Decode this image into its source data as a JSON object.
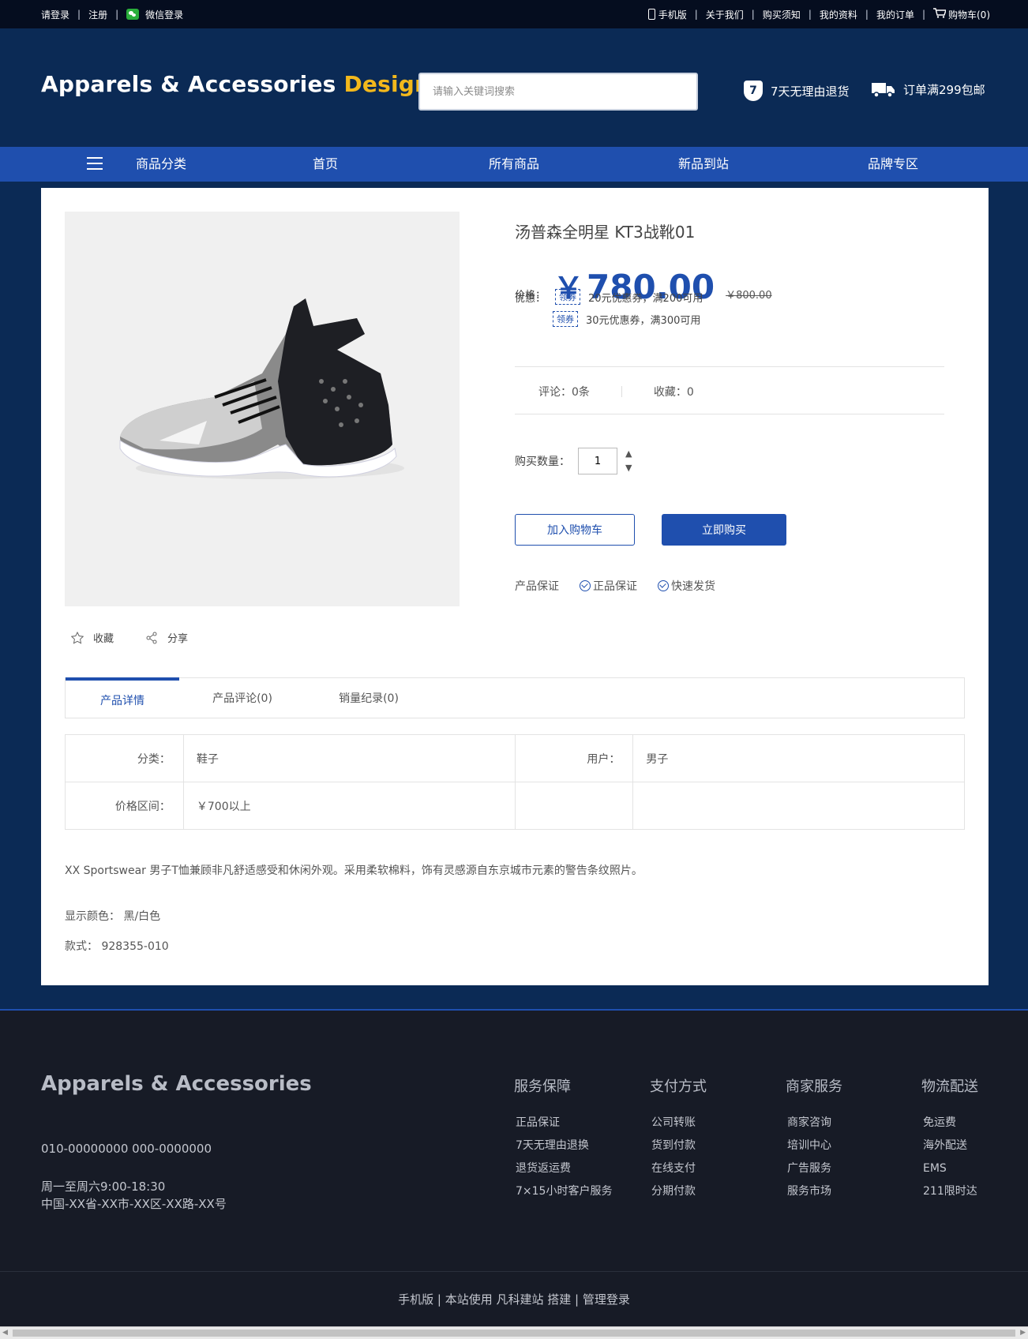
{
  "topbar": {
    "login": "请登录",
    "register": "注册",
    "wechat_login": "微信登录",
    "mobile": "手机版",
    "about": "关于我们",
    "purchase_notice": "购买须知",
    "my_profile": "我的资料",
    "my_orders": "我的订单",
    "cart": "购物车(0)",
    "separator": "|"
  },
  "header": {
    "logo_main": "Apparels & Accessories",
    "logo_accent": "Design",
    "search_placeholder": "请输入关键词搜索",
    "promo_return_badge": "7",
    "promo_return": "7天无理由退货",
    "promo_shipping": "订单满299包邮"
  },
  "nav": {
    "categories": "商品分类",
    "home": "首页",
    "all_products": "所有商品",
    "new_arrivals": "新品到站",
    "brands": "品牌专区"
  },
  "product": {
    "title": "汤普森全明星 KT3战靴01",
    "price_label": "价格：",
    "currency": "￥",
    "price": "780.00",
    "old_price": "￥800.00",
    "discount_label": "优惠：",
    "coupons": [
      {
        "tag": "领券",
        "text": "20元优惠券，满200可用"
      },
      {
        "tag": "领券",
        "text": "30元优惠券，满300可用"
      }
    ],
    "comments": "评论：0条",
    "favorites": "收藏：0",
    "qty_label": "购买数量：",
    "qty_value": "1",
    "add_to_cart": "加入购物车",
    "buy_now": "立即购买",
    "guarantee_label": "产品保证",
    "guarantee_1": "正品保证",
    "guarantee_2": "快速发货",
    "collect": "收藏",
    "share": "分享"
  },
  "tabs": {
    "details": "产品详情",
    "reviews": "产品评论(0)",
    "sales": "销量纪录(0)"
  },
  "specs": {
    "category_label": "分类：",
    "category_value": "鞋子",
    "user_label": "用户：",
    "user_value": "男子",
    "price_range_label": "价格区间：",
    "price_range_value": "￥700以上"
  },
  "description": {
    "text": "XX Sportswear 男子T恤兼顾非凡舒适感受和休闲外观。采用柔软棉料，饰有灵感源自东京城市元素的警告条纹照片。",
    "color_label": "显示颜色：",
    "color_value": "黑/白色",
    "style_label": "款式：",
    "style_value": "928355-010"
  },
  "footer": {
    "logo": "Apparels & Accessories",
    "phone": "010-00000000 000-0000000",
    "hours": "周一至周六9:00-18:30",
    "address": "中国-XX省-XX市-XX区-XX路-XX号",
    "columns": [
      {
        "title": "服务保障",
        "items": [
          "正品保证",
          "7天无理由退换",
          "退货返运费",
          "7×15小时客户服务"
        ]
      },
      {
        "title": "支付方式",
        "items": [
          "公司转账",
          "货到付款",
          "在线支付",
          "分期付款"
        ]
      },
      {
        "title": "商家服务",
        "items": [
          "商家咨询",
          "培训中心",
          "广告服务",
          "服务市场"
        ]
      },
      {
        "title": "物流配送",
        "items": [
          "免运费",
          "海外配送",
          "EMS",
          "211限时达"
        ]
      }
    ],
    "bottom": "手机版 | 本站使用 凡科建站 搭建 | 管理登录"
  },
  "colors": {
    "brand_blue": "#1f4fae",
    "header_bg": "#0b2a55",
    "accent_yellow": "#f3b81c",
    "footer_bg": "#171b26"
  }
}
